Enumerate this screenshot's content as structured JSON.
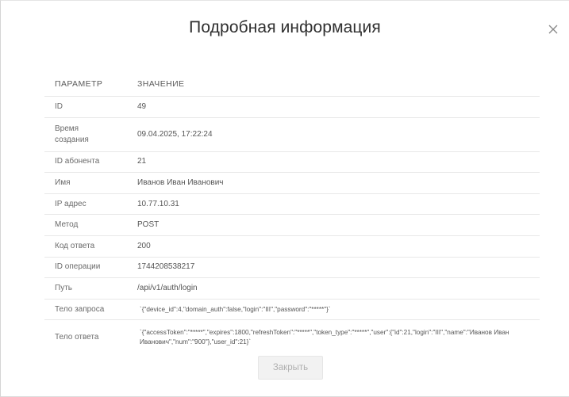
{
  "modal": {
    "title": "Подробная информация",
    "close_label": "Закрыть"
  },
  "table": {
    "headers": {
      "param": "ПАРАМЕТР",
      "value": "ЗНАЧЕНИЕ"
    },
    "rows": [
      {
        "param": "ID",
        "value": "49"
      },
      {
        "param": "Время создания",
        "value": "09.04.2025, 17:22:24"
      },
      {
        "param": "ID абонента",
        "value": "21"
      },
      {
        "param": "Имя",
        "value": "Иванов Иван Иванович"
      },
      {
        "param": "IP адрес",
        "value": "10.77.10.31"
      },
      {
        "param": "Метод",
        "value": "POST"
      },
      {
        "param": "Код ответа",
        "value": "200"
      },
      {
        "param": "ID операции",
        "value": "1744208538217"
      },
      {
        "param": "Путь",
        "value": "/api/v1/auth/login"
      },
      {
        "param": "Тело запроса",
        "value": "`{\"device_id\":4,\"domain_auth\":false,\"login\":\"III\",\"password\":\"*****\"}`"
      },
      {
        "param": "Тело ответа",
        "value": "`{\"accessToken\":\"*****\",\"expires\":1800,\"refreshToken\":\"*****\",\"token_type\":\"*****\",\"user\":{\"id\":21,\"login\":\"III\",\"name\":\"Иванов Иван Иванович\",\"num\":\"900\"},\"user_id\":21}`"
      }
    ]
  },
  "colors": {
    "title": "#2f2f2f",
    "text": "#555555",
    "border": "#e8e8e8",
    "button_bg": "#f2f2f2",
    "button_text": "#b0b0b0"
  },
  "icons": {
    "close": "close-icon"
  }
}
